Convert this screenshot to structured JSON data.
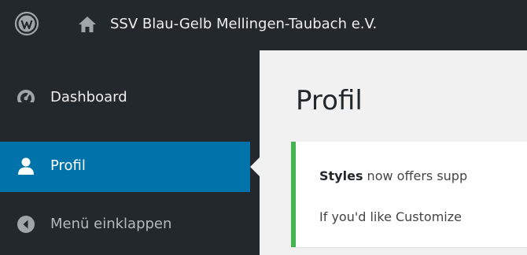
{
  "adminbar": {
    "site_name": "SSV Blau-Gelb Mellingen-Taubach e.V.",
    "logo_icon": "wordpress-logo-icon",
    "home_icon": "home-icon"
  },
  "sidebar": {
    "items": [
      {
        "label": "Dashboard",
        "icon": "dashboard-icon",
        "active": false
      },
      {
        "label": "Profil",
        "icon": "user-icon",
        "active": true
      },
      {
        "label": "Menü einklappen",
        "icon": "collapse-icon",
        "active": false
      }
    ]
  },
  "main": {
    "title": "Profil",
    "notice": {
      "line1_strong": "Styles",
      "line1_rest": " now offers supp",
      "line2": "If you'd like Customize"
    }
  },
  "colors": {
    "adminbar_bg": "#23282d",
    "active_bg": "#0073aa",
    "notice_border": "#46b450",
    "page_bg": "#f1f1f1"
  }
}
